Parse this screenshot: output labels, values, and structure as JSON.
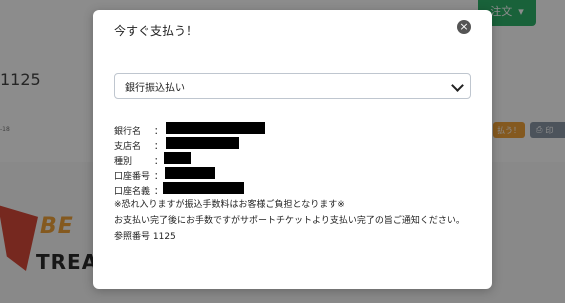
{
  "background": {
    "header_button_label": "注文",
    "order_text": "1125",
    "date_fragment": "-18",
    "pay_button_label": "払う！",
    "print_button_label": "印",
    "logo_top": "BE",
    "logo_bottom": "TREA"
  },
  "modal": {
    "title": "今すぐ支払う！",
    "payment_method": {
      "selected": "銀行振込払い"
    },
    "fields": [
      {
        "label": "銀行名",
        "colon": "："
      },
      {
        "label": "支店名",
        "colon": "："
      },
      {
        "label": "種別",
        "colon": "："
      },
      {
        "label": "口座番号",
        "colon": "："
      },
      {
        "label": "口座名義",
        "colon": "："
      }
    ],
    "notes": {
      "fee_note": "※恐れ入りますが振込手数料はお客様ご負担となります※",
      "completion_note": "お支払い完了後にお手数ですがサポートチケットより支払い完了の旨ご通知ください。",
      "reference": "参照番号 1125"
    }
  },
  "colors": {
    "overlay": "#000000",
    "green_button": "#2fb36b",
    "orange_button": "#f0a33a",
    "gray_button": "#8a97a7",
    "logo_red": "#d84a3a"
  },
  "icons": {
    "close": "x-circle-icon",
    "select_arrow": "chevron-down-icon",
    "print": "print-icon",
    "header_caret": "chevron-down-icon"
  }
}
